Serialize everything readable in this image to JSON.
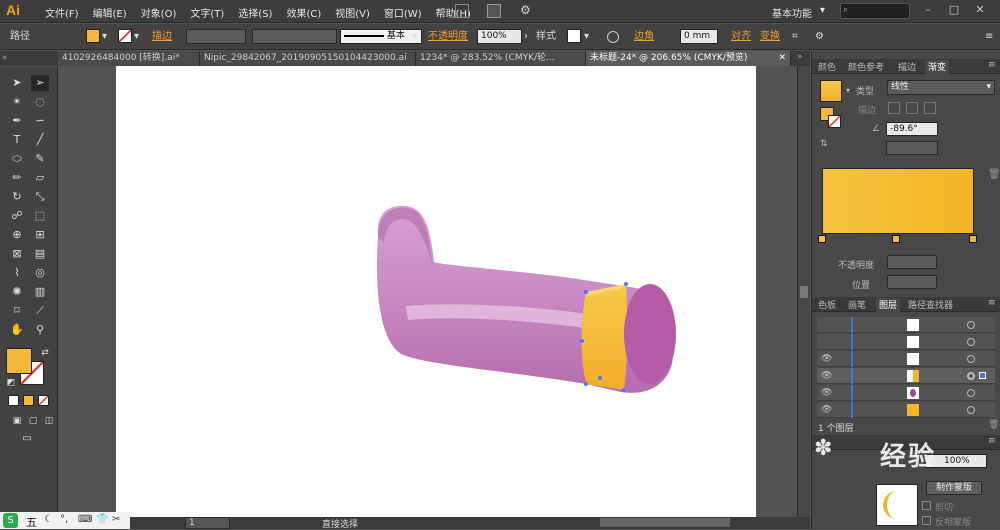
{
  "app": {
    "logo": "Ai"
  },
  "menu": [
    "文件(F)",
    "编辑(E)",
    "对象(O)",
    "文字(T)",
    "选择(S)",
    "效果(C)",
    "视图(V)",
    "窗口(W)",
    "帮助(H)"
  ],
  "workspace": "基本功能",
  "control": {
    "path_label": "路径",
    "stroke_label": "描边",
    "stroke_style": "基本",
    "opacity_label": "不透明度",
    "opacity_value": "100%",
    "style_label": "样式",
    "corner_label": "边角",
    "corner_value": "0 mm",
    "align_label": "对齐",
    "transform_label": "变换"
  },
  "tabs": [
    "4102926484000 [转换].ai*",
    "Nipic_29842067_20190905150104423000.ai",
    "1234* @ 283.52% (CMYK/轮...",
    "未标题-24* @ 206.65% (CMYK/预览)"
  ],
  "panels": {
    "top_tabs": [
      "颜色",
      "颜色参考",
      "描边",
      "渐变"
    ],
    "gradient": {
      "type_label": "类型",
      "type_value": "线性",
      "stroke_label": "描边",
      "angle": "-89.6°",
      "opacity_label": "不透明度",
      "position_label": "位置",
      "start_color": "#f5c33e",
      "end_color": "#f3b628"
    },
    "layer_tabs": [
      "色板",
      "画笔",
      "图层",
      "路径查找器"
    ],
    "layers_count": "1 个图层",
    "transparency": {
      "opacity_value": "100%",
      "make_mask": "制作蒙版",
      "clip": "剪切",
      "invert_mask": "反相蒙版"
    }
  },
  "status": {
    "zoom": "1",
    "tool": "直接选择"
  },
  "taskbar": {
    "ime": "五"
  },
  "watermark": {
    "text": "经验"
  },
  "colors": {
    "accent_fill": "#f5b83a",
    "shape_main": "#c47fc0",
    "ring": "#f4b534"
  }
}
